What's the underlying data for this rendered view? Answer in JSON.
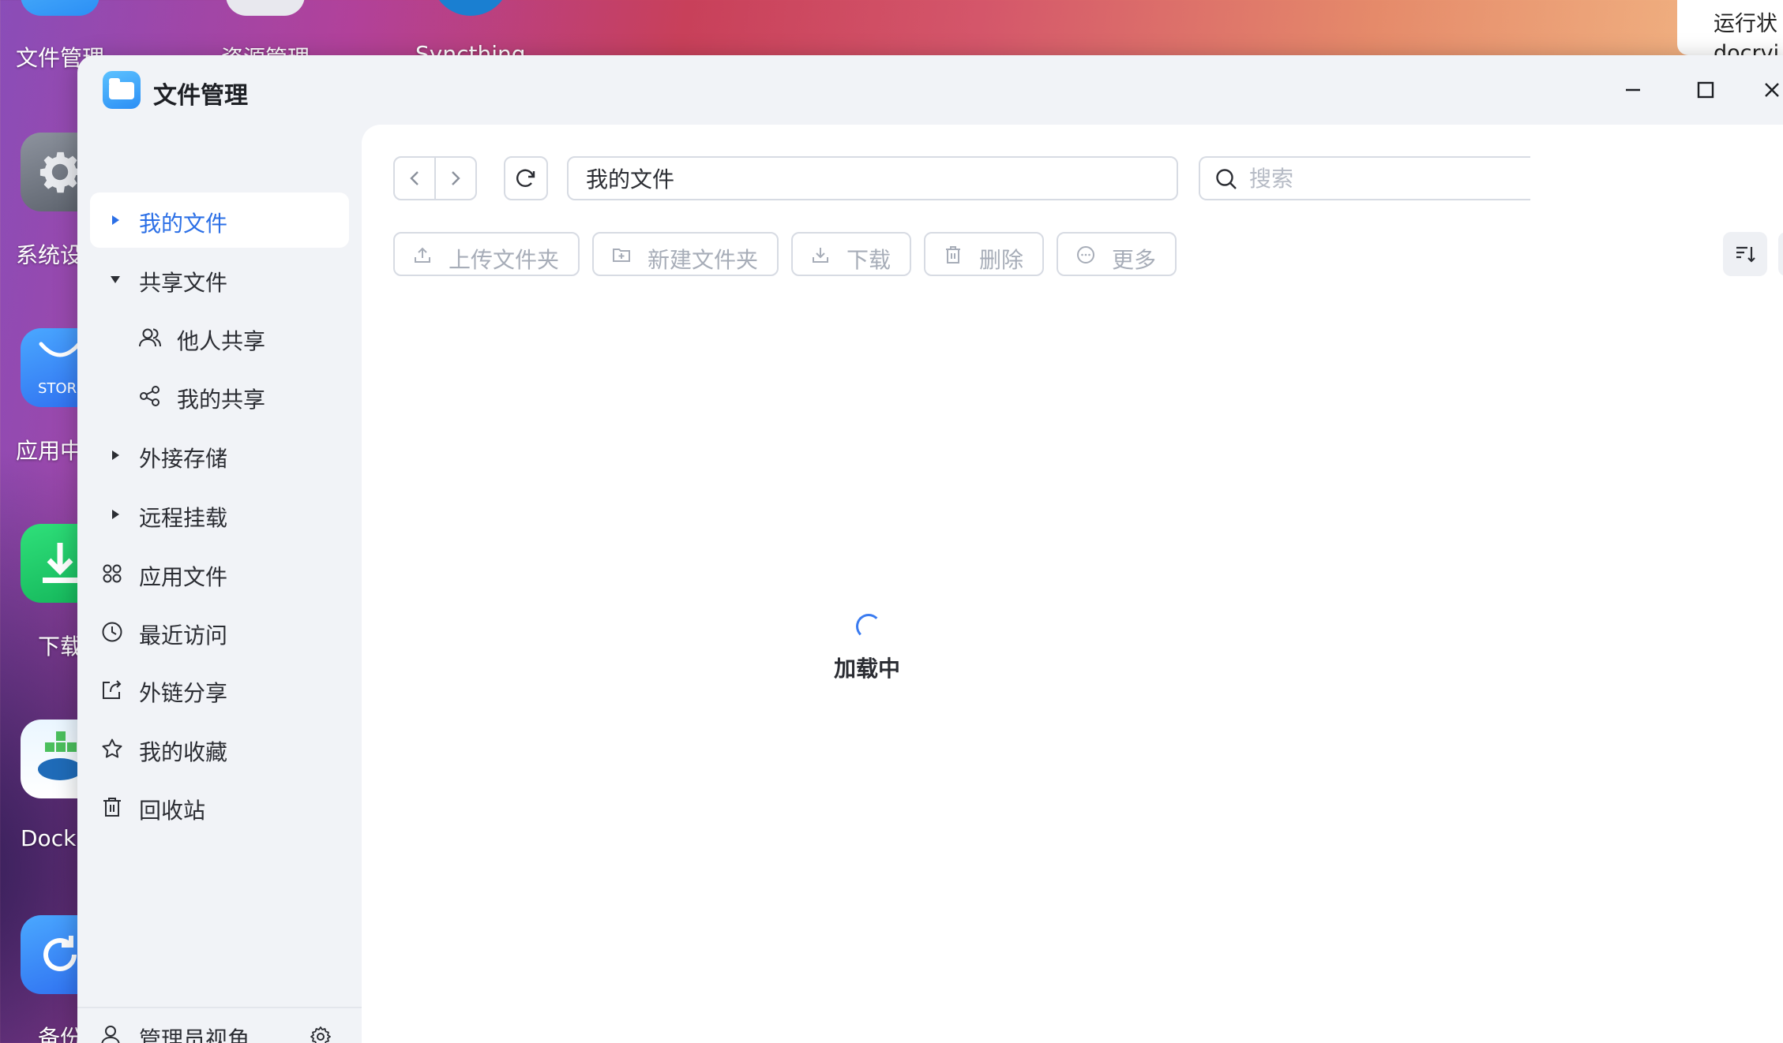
{
  "desktop": {
    "icons": [
      {
        "label": "文件管理"
      },
      {
        "label": "资源管理"
      },
      {
        "label": "Syncthing"
      },
      {
        "label": "系统设"
      },
      {
        "label": "应用中"
      },
      {
        "label": "下载"
      },
      {
        "label": "Dock"
      },
      {
        "label": "备份"
      }
    ],
    "store_badge": "STOR",
    "right_panel": {
      "line1": "运行状",
      "line2": "docrvi"
    }
  },
  "window": {
    "title": "文件管理"
  },
  "sidebar": {
    "items": [
      {
        "label": "我的文件",
        "icon": "caret-right-icon"
      },
      {
        "label": "共享文件",
        "icon": "caret-down-icon"
      },
      {
        "label": "他人共享",
        "icon": "users-icon"
      },
      {
        "label": "我的共享",
        "icon": "share-icon"
      },
      {
        "label": "外接存储",
        "icon": "caret-right-icon"
      },
      {
        "label": "远程挂载",
        "icon": "caret-right-icon"
      },
      {
        "label": "应用文件",
        "icon": "apps-icon"
      },
      {
        "label": "最近访问",
        "icon": "clock-icon"
      },
      {
        "label": "外链分享",
        "icon": "external-share-icon"
      },
      {
        "label": "我的收藏",
        "icon": "star-icon"
      },
      {
        "label": "回收站",
        "icon": "trash-icon"
      }
    ],
    "admin_label": "管理员视角"
  },
  "toolbar": {
    "path": "我的文件",
    "search_placeholder": "搜索",
    "buttons": [
      {
        "label": "上传文件夹",
        "icon": "upload-icon"
      },
      {
        "label": "新建文件夹",
        "icon": "new-folder-icon"
      },
      {
        "label": "下载",
        "icon": "download-icon"
      },
      {
        "label": "删除",
        "icon": "delete-icon"
      },
      {
        "label": "更多",
        "icon": "more-icon"
      }
    ]
  },
  "content": {
    "loading_text": "加载中"
  },
  "colors": {
    "accent": "#2b6fe6",
    "disabled_text": "#a7adb8"
  }
}
